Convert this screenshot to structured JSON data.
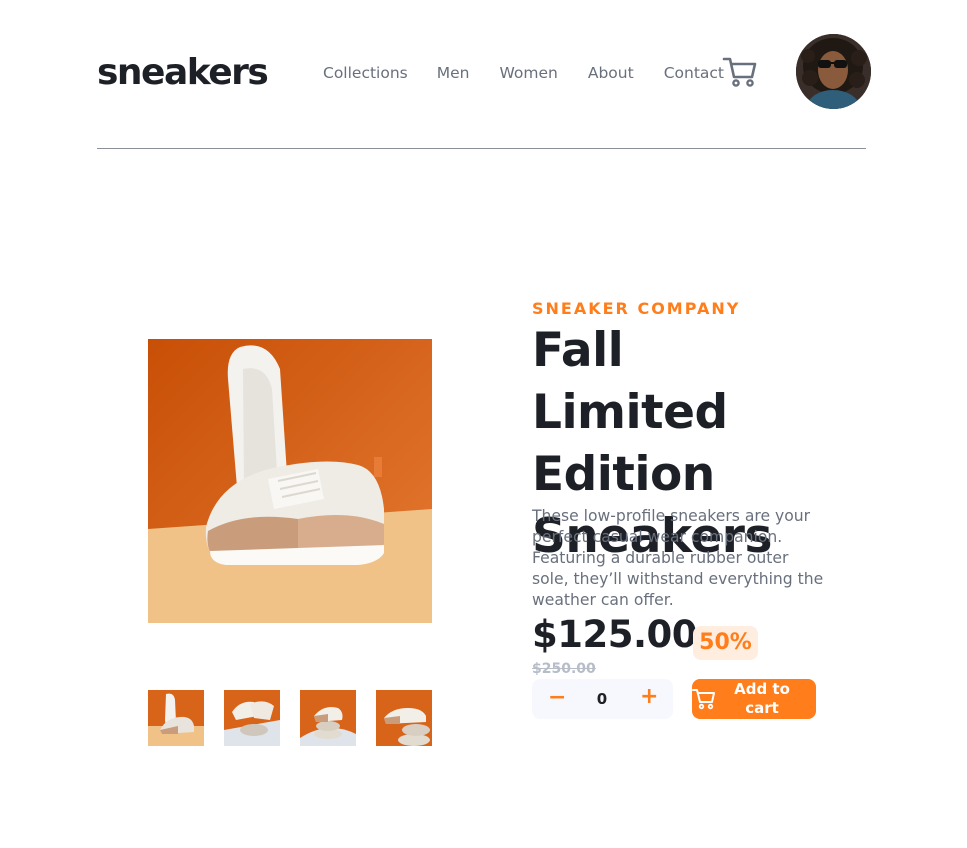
{
  "header": {
    "logo": "sneakers",
    "nav": [
      "Collections",
      "Men",
      "Women",
      "About",
      "Contact"
    ]
  },
  "product": {
    "company": "SNEAKER COMPANY",
    "title": "Fall Limited Edition Sneakers",
    "description": "These low-profile sneakers are your perfect casual wear companion. Featuring a durable rubber outer sole, they’ll withstand everything the weather can offer.",
    "price": "$125.00",
    "discount": "50%",
    "old_price": "$250.00",
    "quantity": "0",
    "qty_minus": "−",
    "qty_plus": "+",
    "add_to_cart": "Add to cart"
  },
  "icons": {
    "cart": "cart-icon",
    "avatar": "user-avatar"
  },
  "colors": {
    "accent": "#ff7d1a",
    "accent_light": "#ffede0",
    "dark": "#1d2026",
    "grey": "#69707d",
    "light_grey": "#b6bcc8",
    "qty_bg": "#f6f8fd"
  }
}
